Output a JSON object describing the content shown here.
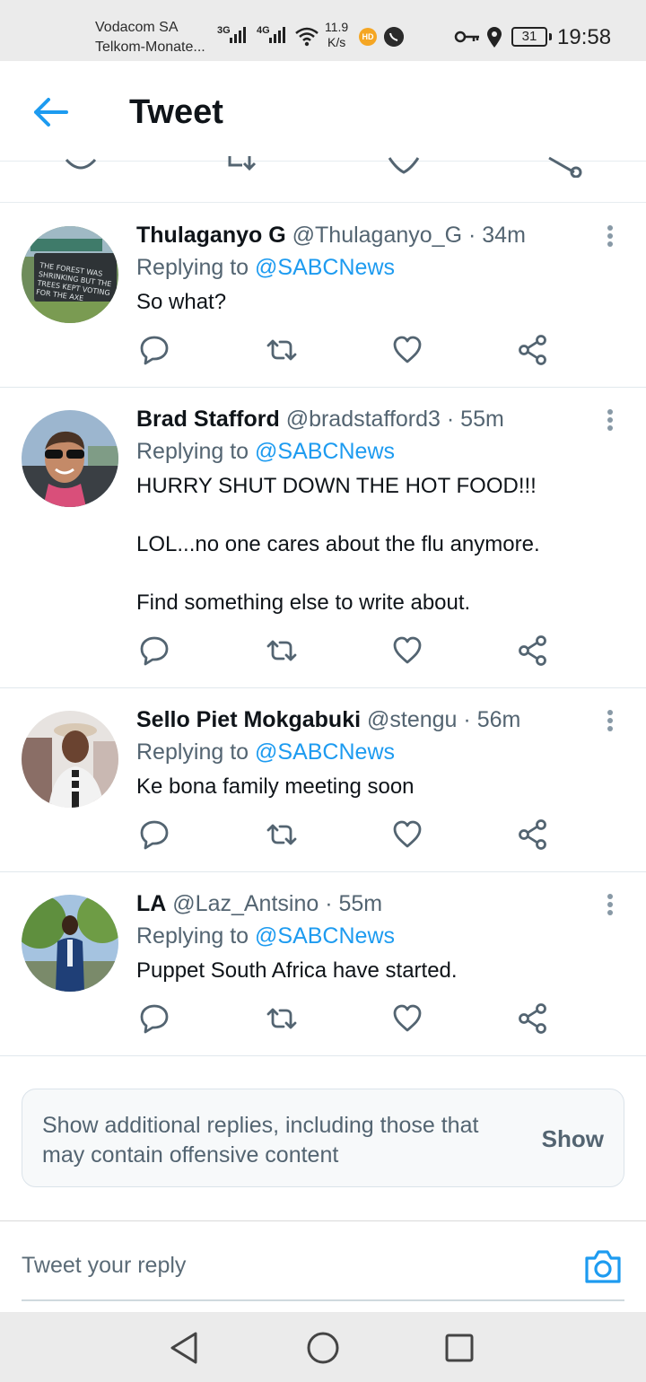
{
  "status_bar": {
    "carrier_1": "Vodacom SA",
    "carrier_2": "Telkom-Monate...",
    "net_1": "3G",
    "net_2": "4G",
    "speed_value": "11.9",
    "speed_unit": "K/s",
    "hd_badge": "HD",
    "battery": "31",
    "time": "19:58",
    "icons": [
      "signal-icon",
      "wifi-icon",
      "hd-icon",
      "whatsapp-icon",
      "key-icon",
      "location-icon",
      "battery-icon"
    ]
  },
  "header": {
    "title": "Tweet",
    "back_icon": "back-arrow-icon"
  },
  "tweets": [
    {
      "name": "Thulaganyo G",
      "handle": "@Thulaganyo_G",
      "separator": "·",
      "time": "34m",
      "replying_prefix": "Replying to ",
      "replying_to": "@SABCNews",
      "text": [
        "So what?"
      ],
      "avatar_sign_text": "THE FOREST WAS SHRINKING BUT THE TREES KEPT VOTING FOR THE AXE"
    },
    {
      "name": "Brad Stafford",
      "handle": "@bradstafford3",
      "separator": "·",
      "time": "55m",
      "replying_prefix": "Replying to ",
      "replying_to": "@SABCNews",
      "text": [
        "HURRY SHUT DOWN THE HOT FOOD!!!",
        "LOL...no one cares about the flu anymore.",
        "Find something else to write about."
      ]
    },
    {
      "name": "Sello Piet Mokgabuki",
      "handle": "@stengu",
      "separator": "·",
      "time": "56m",
      "replying_prefix": "Replying to ",
      "replying_to": "@SABCNews",
      "text": [
        "Ke bona family meeting soon"
      ]
    },
    {
      "name": "LA",
      "handle": "@Laz_Antsino",
      "separator": "·",
      "time": "55m",
      "replying_prefix": "Replying to ",
      "replying_to": "@SABCNews",
      "text": [
        "Puppet South Africa have started."
      ]
    }
  ],
  "show_more": {
    "text": "Show additional replies, including those that may contain offensive content",
    "button": "Show"
  },
  "reply_box": {
    "placeholder": "Tweet your reply"
  },
  "colors": {
    "accent": "#1d9bf0",
    "secondary_text": "#536471",
    "icon_gray": "#536471",
    "status_bar": "#ebebeb"
  }
}
